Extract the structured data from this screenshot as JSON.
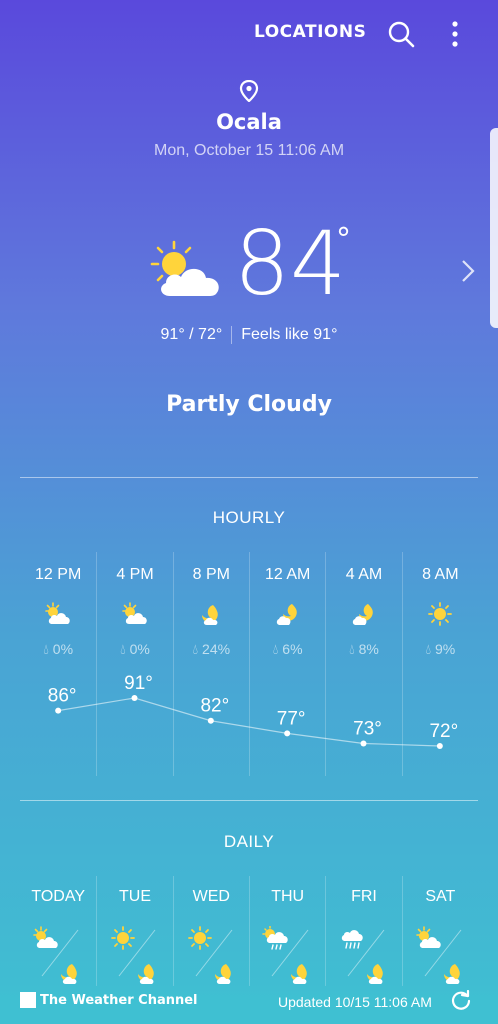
{
  "topbar": {
    "locations_label": "LOCATIONS",
    "search_icon": "search-icon",
    "more_icon": "more-vert-icon"
  },
  "location": {
    "city": "Ocala",
    "datetime": "Mon, October 15 11:06 AM"
  },
  "current": {
    "temperature": "84",
    "degree": "°",
    "high_low": "91° / 72°",
    "feels_like": "Feels like 91°",
    "condition": "Partly Cloudy",
    "icon": "partly-cloudy-day-icon"
  },
  "hourly": {
    "title": "HOURLY",
    "items": [
      {
        "time": "12 PM",
        "icon": "partly-cloudy-day-icon",
        "precip": "0%",
        "temp": "86°"
      },
      {
        "time": "4 PM",
        "icon": "partly-cloudy-day-icon",
        "precip": "0%",
        "temp": "91°"
      },
      {
        "time": "8 PM",
        "icon": "clear-night-icon",
        "precip": "24%",
        "temp": "82°"
      },
      {
        "time": "12 AM",
        "icon": "partly-cloudy-night-icon",
        "precip": "6%",
        "temp": "77°"
      },
      {
        "time": "4 AM",
        "icon": "partly-cloudy-night-icon",
        "precip": "8%",
        "temp": "73°"
      },
      {
        "time": "8 AM",
        "icon": "sunny-icon",
        "precip": "9%",
        "temp": "72°"
      }
    ],
    "temps": [
      86,
      91,
      82,
      77,
      73,
      72
    ]
  },
  "daily": {
    "title": "DAILY",
    "items": [
      {
        "day": "TODAY",
        "day_icon": "partly-cloudy-day-icon",
        "night_icon": "clear-night-icon"
      },
      {
        "day": "TUE",
        "day_icon": "sunny-icon",
        "night_icon": "clear-night-icon"
      },
      {
        "day": "WED",
        "day_icon": "sunny-icon",
        "night_icon": "clear-night-icon"
      },
      {
        "day": "THU",
        "day_icon": "rain-day-icon",
        "night_icon": "clear-night-icon"
      },
      {
        "day": "FRI",
        "day_icon": "rain-icon",
        "night_icon": "clear-night-icon"
      },
      {
        "day": "SAT",
        "day_icon": "partly-cloudy-day-icon",
        "night_icon": "clear-night-icon"
      }
    ]
  },
  "footer": {
    "brand": "The Weather Channel",
    "updated": "Updated  10/15  11:06 AM"
  },
  "colors": {
    "sun": "#ffd43b",
    "cloud": "#ffffff",
    "bg_top": "#5a49dc",
    "bg_bottom": "#3fc0d2"
  }
}
